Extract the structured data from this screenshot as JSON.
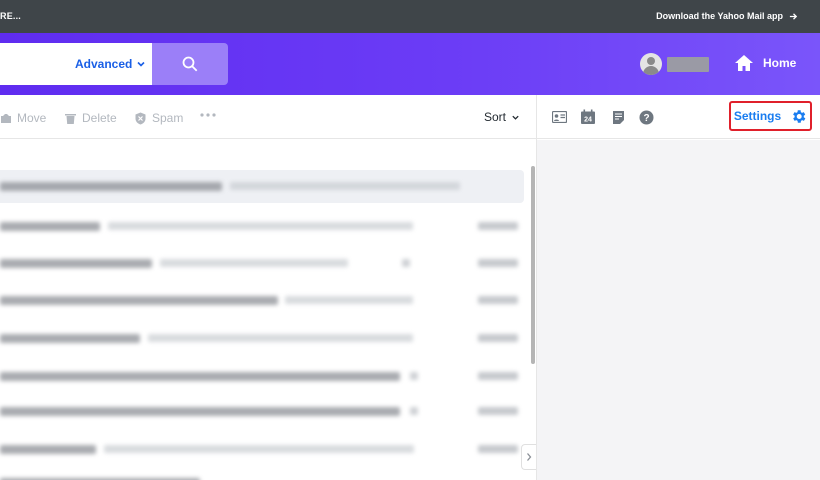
{
  "topbar": {
    "left_text": "RE...",
    "download_link": "Download the Yahoo Mail app"
  },
  "header": {
    "search": {
      "value": "",
      "advanced_label": "Advanced"
    },
    "home_label": "Home"
  },
  "toolbar": {
    "move_label": "Move",
    "delete_label": "Delete",
    "spam_label": "Spam",
    "sort_label": "Sort"
  },
  "right_pane": {
    "settings_label": "Settings",
    "calendar_label": "24"
  },
  "message_list": {
    "rows": [
      {
        "selected": true
      },
      {
        "selected": false
      },
      {
        "selected": false
      },
      {
        "selected": false
      },
      {
        "selected": false
      },
      {
        "selected": false
      },
      {
        "selected": false
      },
      {
        "selected": false
      },
      {
        "selected": false
      }
    ]
  },
  "colors": {
    "topbar": "#3f4549",
    "header_purple": "#6b3cf6",
    "search_button": "#9b7ff8",
    "link_blue": "#1a7df0",
    "settings_outline": "#e0202b"
  },
  "icons": [
    "search-icon",
    "avatar-icon",
    "home-icon",
    "move-icon",
    "delete-icon",
    "spam-icon",
    "more-icon",
    "contacts-icon",
    "calendar-icon",
    "notepad-icon",
    "help-icon",
    "gear-icon",
    "chevron-right-icon"
  ]
}
